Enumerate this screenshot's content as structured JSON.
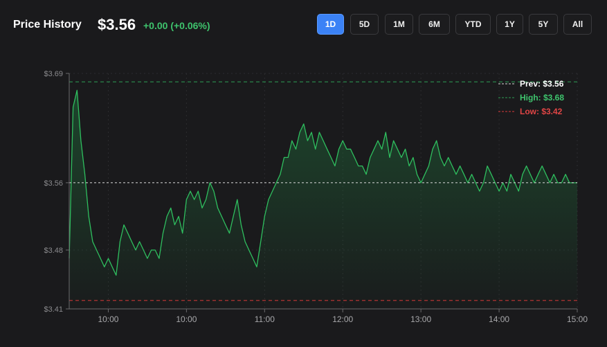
{
  "header": {
    "title": "Price History",
    "price": "$3.56",
    "change": "+0.00 (+0.06%)"
  },
  "ranges": [
    {
      "label": "1D",
      "active": true
    },
    {
      "label": "5D",
      "active": false
    },
    {
      "label": "1M",
      "active": false
    },
    {
      "label": "6M",
      "active": false
    },
    {
      "label": "YTD",
      "active": false
    },
    {
      "label": "1Y",
      "active": false
    },
    {
      "label": "5Y",
      "active": false
    },
    {
      "label": "All",
      "active": false
    }
  ],
  "colors": {
    "line": "#2fbf5f",
    "prev": "#d8d8d8",
    "high": "#2e9e55",
    "low": "#d93a3a",
    "active": "#3b82f6"
  },
  "chart_data": {
    "type": "area",
    "y_ticks": [
      "$3.69",
      "$3.56",
      "$3.48",
      "$3.41"
    ],
    "y_tick_values": [
      3.69,
      3.56,
      3.48,
      3.41
    ],
    "ylim": [
      3.41,
      3.69
    ],
    "x_ticks": [
      "10:00",
      "10:00",
      "11:00",
      "12:00",
      "13:00",
      "14:00",
      "15:00"
    ],
    "x_tick_positions": [
      0.5,
      1.5,
      2.5,
      3.5,
      4.5,
      5.5,
      6.5
    ],
    "xlim": [
      0,
      6.5
    ],
    "legend": [
      {
        "key": "prev",
        "label": "Prev: $3.56",
        "value": 3.56
      },
      {
        "key": "high",
        "label": "High: $3.68",
        "value": 3.68
      },
      {
        "key": "low",
        "label": "Low: $3.42",
        "value": 3.42
      }
    ],
    "legend_position": "top-right",
    "grid": true,
    "x": [
      0,
      0.05,
      0.1,
      0.15,
      0.2,
      0.25,
      0.3,
      0.35,
      0.4,
      0.45,
      0.5,
      0.55,
      0.6,
      0.65,
      0.7,
      0.75,
      0.8,
      0.85,
      0.9,
      0.95,
      1,
      1.05,
      1.1,
      1.15,
      1.2,
      1.25,
      1.3,
      1.35,
      1.4,
      1.45,
      1.5,
      1.55,
      1.6,
      1.65,
      1.7,
      1.75,
      1.8,
      1.85,
      1.9,
      1.95,
      2,
      2.05,
      2.1,
      2.15,
      2.2,
      2.25,
      2.3,
      2.35,
      2.4,
      2.45,
      2.5,
      2.55,
      2.6,
      2.65,
      2.7,
      2.75,
      2.8,
      2.85,
      2.9,
      2.95,
      3,
      3.05,
      3.1,
      3.15,
      3.2,
      3.25,
      3.3,
      3.35,
      3.4,
      3.45,
      3.5,
      3.55,
      3.6,
      3.65,
      3.7,
      3.75,
      3.8,
      3.85,
      3.9,
      3.95,
      4,
      4.05,
      4.1,
      4.15,
      4.2,
      4.25,
      4.3,
      4.35,
      4.4,
      4.45,
      4.5,
      4.55,
      4.6,
      4.65,
      4.7,
      4.75,
      4.8,
      4.85,
      4.9,
      4.95,
      5,
      5.05,
      5.1,
      5.15,
      5.2,
      5.25,
      5.3,
      5.35,
      5.4,
      5.45,
      5.5,
      5.55,
      5.6,
      5.65,
      5.7,
      5.75,
      5.8,
      5.85,
      5.9,
      5.95,
      6,
      6.05,
      6.1,
      6.15,
      6.2,
      6.25,
      6.3,
      6.35,
      6.4,
      6.45,
      6.5
    ],
    "values": [
      3.47,
      3.65,
      3.67,
      3.61,
      3.57,
      3.52,
      3.49,
      3.48,
      3.47,
      3.46,
      3.47,
      3.46,
      3.45,
      3.49,
      3.51,
      3.5,
      3.49,
      3.48,
      3.49,
      3.48,
      3.47,
      3.48,
      3.48,
      3.47,
      3.5,
      3.52,
      3.53,
      3.51,
      3.52,
      3.5,
      3.54,
      3.55,
      3.54,
      3.55,
      3.53,
      3.54,
      3.56,
      3.55,
      3.53,
      3.52,
      3.51,
      3.5,
      3.52,
      3.54,
      3.51,
      3.49,
      3.48,
      3.47,
      3.46,
      3.49,
      3.52,
      3.54,
      3.55,
      3.56,
      3.57,
      3.59,
      3.59,
      3.61,
      3.6,
      3.62,
      3.63,
      3.61,
      3.62,
      3.6,
      3.62,
      3.61,
      3.6,
      3.59,
      3.58,
      3.6,
      3.61,
      3.6,
      3.6,
      3.59,
      3.58,
      3.58,
      3.57,
      3.59,
      3.6,
      3.61,
      3.6,
      3.62,
      3.59,
      3.61,
      3.6,
      3.59,
      3.6,
      3.58,
      3.59,
      3.57,
      3.56,
      3.57,
      3.58,
      3.6,
      3.61,
      3.59,
      3.58,
      3.59,
      3.58,
      3.57,
      3.58,
      3.57,
      3.56,
      3.57,
      3.56,
      3.55,
      3.56,
      3.58,
      3.57,
      3.56,
      3.55,
      3.56,
      3.55,
      3.57,
      3.56,
      3.55,
      3.57,
      3.58,
      3.57,
      3.56,
      3.57,
      3.58,
      3.57,
      3.56,
      3.57,
      3.56,
      3.56,
      3.57,
      3.56,
      3.56,
      3.56
    ]
  }
}
